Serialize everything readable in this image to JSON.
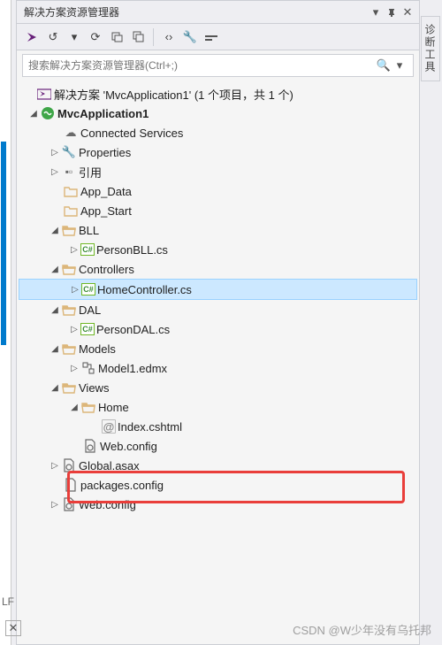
{
  "panel_title": "解决方案资源管理器",
  "search_placeholder": "搜索解决方案资源管理器(Ctrl+;)",
  "solution_line": "解决方案 'MvcApplication1' (1 个项目，共 1 个)",
  "project_name": "MvcApplication1",
  "right_tab": "诊断工具",
  "bottom_label": "LF",
  "watermark": "CSDN @W少年没有乌托邦",
  "nodes": {
    "connected_services": "Connected Services",
    "properties": "Properties",
    "references": "引用",
    "app_data": "App_Data",
    "app_start": "App_Start",
    "bll": "BLL",
    "person_bll": "PersonBLL.cs",
    "controllers": "Controllers",
    "home_controller": "HomeController.cs",
    "dal": "DAL",
    "person_dal": "PersonDAL.cs",
    "models": "Models",
    "model1": "Model1.edmx",
    "views": "Views",
    "home": "Home",
    "index": "Index.cshtml",
    "web_config_views": "Web.config",
    "global_asax": "Global.asax",
    "packages_config": "packages.config",
    "web_config": "Web.config"
  }
}
